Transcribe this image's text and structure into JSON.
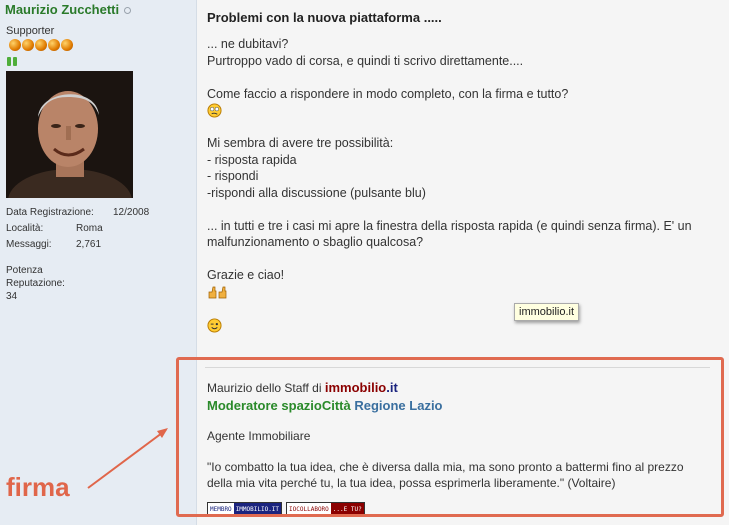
{
  "user": {
    "name": "Maurizio Zucchetti",
    "title": "Supporter",
    "stars_count": 5,
    "reputation_pips": 2,
    "info": [
      {
        "label": "Data Registrazione:",
        "value": "12/2008"
      },
      {
        "label": "Località:",
        "value": "Roma"
      },
      {
        "label": "Messaggi:",
        "value": "2,761"
      }
    ],
    "reputation_label": "Potenza Reputazione:",
    "reputation_value": "34"
  },
  "post": {
    "title": "Problemi con la nuova piattaforma .....",
    "p1": "... ne dubitavi?\nPurtroppo vado di corsa, e quindi ti scrivo direttamente....",
    "p2": "Come faccio a rispondere in modo completo, con la firma e tutto?",
    "p3": "Mi sembra di avere tre possibilità:\n- risposta rapida\n- rispondi\n-rispondi alla discussione (pulsante blu)",
    "p4": "... in tutti e tre i casi mi apre la finestra della risposta rapida (e quindi senza firma). E' un malfunzionamento o sbaglio qualcosa?",
    "p5": "Grazie e ciao!",
    "tooltip": "immobilio.it"
  },
  "signature": {
    "intro": "Maurizio dello Staff di",
    "brand_a": "immobilio",
    "brand_b": ".it",
    "mod_role": "Moderatore spazioCittà",
    "mod_region": "Regione Lazio",
    "agent": "Agente Immobiliare",
    "quote": "\"Io combatto la tua idea, che è diversa dalla mia, ma sono pronto a battermi fino al prezzo della mia vita perché tu, la tua idea, possa esprimerla liberamente.\" (Voltaire)",
    "badge1_left": "MEMBRO",
    "badge1_right": "IMMOBILIO.IT",
    "badge2_left": "IOCOLLABORO",
    "badge2_right": "...E TU?"
  },
  "annotation": {
    "label": "firma",
    "color": "#e0664a"
  },
  "colors": {
    "username": "#2a7a2a",
    "sidebar_bg": "#e6ecf3",
    "main_bg": "#f5f5f5",
    "brand_red": "#8b0000",
    "brand_navy": "#1a237e"
  }
}
